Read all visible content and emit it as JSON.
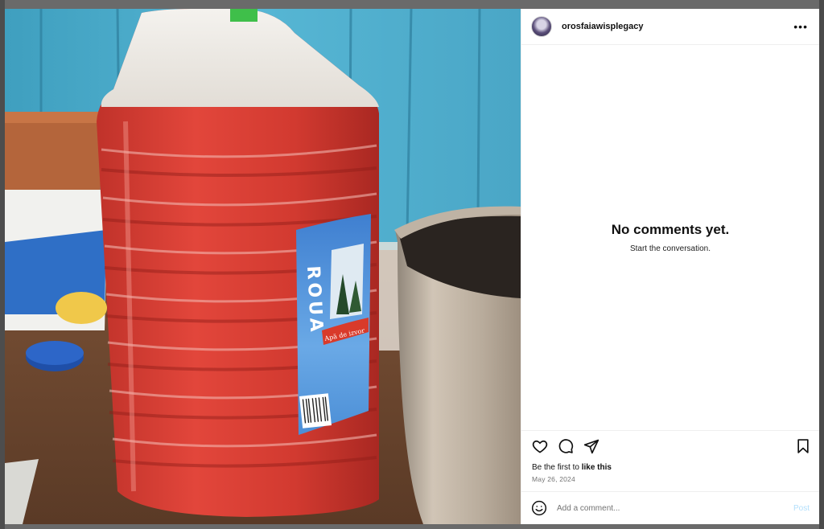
{
  "post": {
    "username": "orosfaiawisplegacy",
    "more_label": "•••",
    "no_comments_title": "No comments yet.",
    "no_comments_subtitle": "Start the conversation.",
    "likes_prefix": "Be the first to ",
    "likes_link": "like this",
    "date": "May 26, 2024",
    "comment_placeholder": "Add a comment...",
    "post_label": "Post"
  },
  "photo": {
    "label_brand": "ROUA",
    "label_tagline": "Apă de izvor"
  },
  "icons": {
    "like": "heart-icon",
    "comment": "comment-icon",
    "share": "share-icon",
    "save": "bookmark-icon",
    "emoji": "emoji-icon"
  },
  "colors": {
    "post_button": "#b2dffc",
    "secondary_text": "#737373"
  }
}
